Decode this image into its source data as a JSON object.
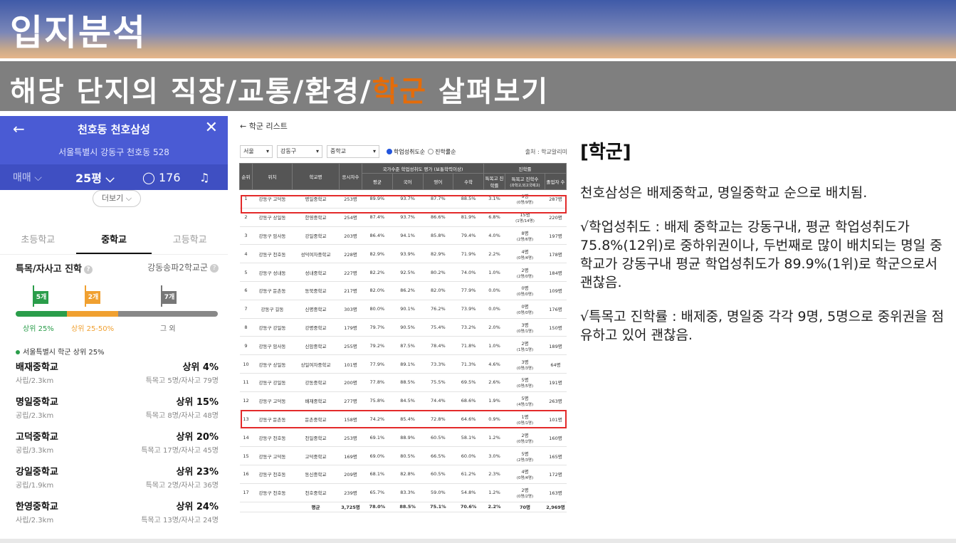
{
  "header": {
    "title": "입지분석",
    "subtitle_pre": "해당 단지의 직장/교통/환경/",
    "subtitle_accent": "학군",
    "subtitle_post": " 살펴보기"
  },
  "mobile": {
    "back": "←",
    "title": "천호동 천호삼성",
    "close": "✕",
    "address": "서울특별시 강동구 천호동 528",
    "tab_trade": "매매 ⌵",
    "tab_size": "25평 ⌵",
    "tab_comments": "◯ 176",
    "bell": "♫",
    "more": "더보기 ⌵",
    "school_tabs": [
      "초등학교",
      "중학교",
      "고등학교"
    ],
    "admission_label": "특목/자사고 진학",
    "district": "강동송파2학교군",
    "flags": [
      "5개",
      "2개",
      "7개"
    ],
    "legend": [
      "상위 25%",
      "상위 25-50%",
      "그 외"
    ],
    "top25_note": "서울특별시 학군 상위 25%",
    "schools": [
      {
        "name": "배재중학교",
        "rank": "상위 4%",
        "sub": "사립/2.3km",
        "count": "특목고 5명/자사고 79명"
      },
      {
        "name": "명일중학교",
        "rank": "상위 15%",
        "sub": "공립/2.3km",
        "count": "특목고 8명/자사고 48명"
      },
      {
        "name": "고덕중학교",
        "rank": "상위 20%",
        "sub": "공립/3.3km",
        "count": "특목고 17명/자사고 45명"
      },
      {
        "name": "강일중학교",
        "rank": "상위 23%",
        "sub": "공립/1.9km",
        "count": "특목고 2명/자사고 36명"
      },
      {
        "name": "한영중학교",
        "rank": "상위 24%",
        "sub": "사립/2.3km",
        "count": "특목고 13명/자사고 24명"
      }
    ]
  },
  "table": {
    "title": "← 학군 리스트",
    "filter_city": "서울",
    "filter_gu": "강동구",
    "filter_type": "중학교",
    "radio_1": "학업성취도순",
    "radio_2": "진학률순",
    "source": "출처 : 학교알리미",
    "head_group1": "국가수준 학업성취도 평가 (보통학력이상)",
    "head_group2": "진학률",
    "headers": [
      "순위",
      "위치",
      "학교명",
      "응시자수",
      "평균",
      "국어",
      "영어",
      "수학",
      "특목고 진학률",
      "특목고 진학수",
      "졸업자 수"
    ],
    "sub_note": "(과학고,외고국제고)",
    "rows": [
      [
        "1",
        "강동구 고덕동",
        "명일중학교",
        "253명",
        "89.9%",
        "93.7%",
        "87.7%",
        "88.5%",
        "3.1%",
        "9명",
        "(0명/9명)",
        "287명"
      ],
      [
        "2",
        "강동구 상일동",
        "한영중학교",
        "254명",
        "87.4%",
        "93.7%",
        "86.6%",
        "81.9%",
        "6.8%",
        "15명",
        "(1명/14명)",
        "220명"
      ],
      [
        "3",
        "강동구 암사동",
        "강일중학교",
        "203명",
        "86.4%",
        "94.1%",
        "85.8%",
        "79.4%",
        "4.0%",
        "8명",
        "(2명/6명)",
        "197명"
      ],
      [
        "4",
        "강동구 천호동",
        "성덕여자중학교",
        "228명",
        "82.9%",
        "93.9%",
        "82.9%",
        "71.9%",
        "2.2%",
        "4명",
        "(0명/4명)",
        "178명"
      ],
      [
        "5",
        "강동구 성내동",
        "성내중학교",
        "227명",
        "82.2%",
        "92.5%",
        "80.2%",
        "74.0%",
        "1.0%",
        "2명",
        "(2명/0명)",
        "184명"
      ],
      [
        "6",
        "강동구 둔촌동",
        "동북중학교",
        "217명",
        "82.0%",
        "86.2%",
        "82.0%",
        "77.9%",
        "0.0%",
        "0명",
        "(0명/0명)",
        "109명"
      ],
      [
        "7",
        "강동구 길동",
        "신명중학교",
        "303명",
        "80.0%",
        "90.1%",
        "76.2%",
        "73.9%",
        "0.0%",
        "0명",
        "(0명/0명)",
        "176명"
      ],
      [
        "8",
        "강동구 강일동",
        "강명중학교",
        "179명",
        "79.7%",
        "90.5%",
        "75.4%",
        "73.2%",
        "2.0%",
        "3명",
        "(0명/1명)",
        "150명"
      ],
      [
        "9",
        "강동구 암사동",
        "신암중학교",
        "255명",
        "79.2%",
        "87.5%",
        "78.4%",
        "71.8%",
        "1.0%",
        "2명",
        "(1명/1명)",
        "189명"
      ],
      [
        "10",
        "강동구 상일동",
        "상일여자중학교",
        "101명",
        "77.9%",
        "89.1%",
        "73.3%",
        "71.3%",
        "4.6%",
        "3명",
        "(0명/3명)",
        "64명"
      ],
      [
        "11",
        "강동구 강일동",
        "강동중학교",
        "200명",
        "77.8%",
        "88.5%",
        "75.5%",
        "69.5%",
        "2.6%",
        "5명",
        "(0명/5명)",
        "191명"
      ],
      [
        "12",
        "강동구 고덕동",
        "배재중학교",
        "277명",
        "75.8%",
        "84.5%",
        "74.4%",
        "68.6%",
        "1.9%",
        "5명",
        "(4명/1명)",
        "263명"
      ],
      [
        "13",
        "강동구 둔촌동",
        "둔촌중학교",
        "158명",
        "74.2%",
        "85.4%",
        "72.8%",
        "64.6%",
        "0.9%",
        "1명",
        "(0명/1명)",
        "101명"
      ],
      [
        "14",
        "강동구 천호동",
        "천일중학교",
        "253명",
        "69.1%",
        "88.9%",
        "60.5%",
        "58.1%",
        "1.2%",
        "2명",
        "(0명/2명)",
        "160명"
      ],
      [
        "15",
        "강동구 고덕동",
        "고덕중학교",
        "169명",
        "69.0%",
        "80.5%",
        "66.5%",
        "60.0%",
        "3.0%",
        "5명",
        "(2명/3명)",
        "165명"
      ],
      [
        "16",
        "강동구 천호동",
        "동신중학교",
        "209명",
        "68.1%",
        "82.8%",
        "60.5%",
        "61.2%",
        "2.3%",
        "4명",
        "(0명/4명)",
        "172명"
      ],
      [
        "17",
        "강동구 천호동",
        "천호중학교",
        "239명",
        "65.7%",
        "83.3%",
        "59.0%",
        "54.8%",
        "1.2%",
        "2명",
        "(0명/2명)",
        "163명"
      ]
    ],
    "avg": [
      "",
      "",
      "평균",
      "3,725명",
      "78.0%",
      "88.5%",
      "75.1%",
      "70.6%",
      "2.2%",
      "70명",
      "",
      "2,969명"
    ]
  },
  "right": {
    "heading": "[학군]",
    "p1": "천호삼성은 배제중학교, 명일중학교 순으로 배치됨.",
    "p2": "√학업성취도 : 배제 중학교는 강동구내, 평균 학업성취도가 75.8%(12위)로 중하위권이나, 두번째로 많이 배치되는 명일 중학교가 강동구내 평균 학업성취도가 89.9%(1위)로 학군으로서 괜찮음.",
    "p3": "√특목고 진학률 : 배제중, 명일중 각각 9명, 5명으로 중위권을 점유하고 있어 괜찮음."
  },
  "colors": {
    "accent": "#e46c0a",
    "mobile_blue": "#4a5bd4",
    "highlight_red": "#e32a2a",
    "green": "#2a9d4a",
    "orange": "#f0a030",
    "gray": "#888888"
  },
  "icons": {
    "back": "arrow-left-icon",
    "close": "close-icon",
    "bell": "bell-icon",
    "chat": "chat-bubble-icon"
  }
}
